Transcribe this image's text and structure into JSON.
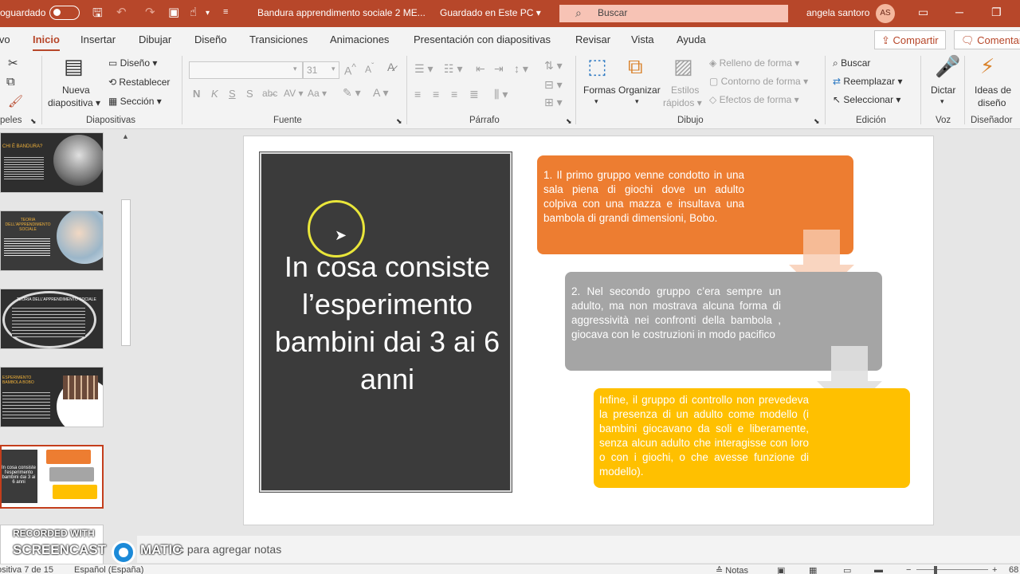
{
  "titlebar": {
    "autosave_label": "oguardado",
    "doc_title": "Bandura apprendimento sociale  2 ME...",
    "save_status": "Guardado en Este PC",
    "search_placeholder": "Buscar",
    "user_name": "angela santoro",
    "user_initials": "AS"
  },
  "tabs": [
    "ivo",
    "Inicio",
    "Insertar",
    "Dibujar",
    "Diseño",
    "Transiciones",
    "Animaciones",
    "Presentación con diapositivas",
    "Revisar",
    "Vista",
    "Ayuda"
  ],
  "share_label": "Compartir",
  "comment_label": "Comentarios",
  "ribbon": {
    "slides": {
      "new_slide": "Nueva",
      "new_slide_2": "diapositiva",
      "layout": "Diseño",
      "reset": "Restablecer",
      "section": "Sección",
      "label": "Diapositivas"
    },
    "clipboard_label": "peles",
    "font": {
      "size": "31",
      "label": "Fuente"
    },
    "paragraph_label": "Párrafo",
    "drawing": {
      "shapes": "Formas",
      "arrange": "Organizar",
      "quick_styles": "Estilos",
      "quick_styles_2": "rápidos",
      "fill": "Relleno de forma",
      "outline": "Contorno de forma",
      "effects": "Efectos de forma",
      "label": "Dibujo"
    },
    "editing": {
      "find": "Buscar",
      "replace": "Reemplazar",
      "select": "Seleccionar",
      "label": "Edición"
    },
    "voice": {
      "dictate": "Dictar",
      "label": "Voz"
    },
    "designer": {
      "ideas": "Ideas de",
      "ideas_2": "diseño",
      "label": "Diseñador"
    }
  },
  "thumbnails": [
    {
      "title": "CHI È BANDURA?"
    },
    {
      "title": "TEORIA DELL'APPRENDIMENTO SOCIALE"
    },
    {
      "title": "TEORIA DELL'APPRENDIMENTO SOCIALE"
    },
    {
      "title": "ESPERIMENTO BAMBOLA BOBO"
    },
    {
      "title": "In cosa consiste l'esperimento bambini dai 3 ai 6 anni"
    },
    {
      "title": ""
    }
  ],
  "slide": {
    "title": "In cosa consiste l’esperimento bambini dai 3 ai 6 anni",
    "box1": "1. Il primo gruppo venne condotto in una sala piena di giochi dove un adulto colpiva con una mazza e insultava una bambola di grandi dimensioni, Bobo.",
    "box2": "2. Nel secondo gruppo c’era sempre un adulto, ma non mostrava alcuna forma di aggressività nei confronti della bambola , giocava con le costruzioni in modo pacifico",
    "box3": "Infine, il gruppo di controllo non prevedeva la presenza di un adulto come modello (i bambini giocavano da soli e liberamente, senza alcun adulto che interagisse con loro o con i giochi, o che avesse funzione di modello).",
    "colors": {
      "orange": "#ed7d31",
      "gray": "#a5a5a5",
      "gold": "#ffc000",
      "dark": "#3b3b3b"
    }
  },
  "notes_placeholder": "Haga clic para agregar notas",
  "notes_visible": "c para agregar notas",
  "statusbar": {
    "slide_count": "ositiva 7 de 15",
    "language": "Español (España)",
    "notes_button": "Notas",
    "zoom": "68"
  },
  "watermark": {
    "line1": "RECORDED WITH",
    "line2": "SCREENCAST",
    "line3": "MATIC"
  }
}
